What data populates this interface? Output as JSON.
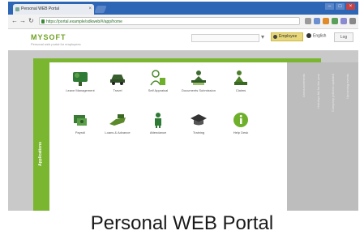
{
  "browser": {
    "tab_title": "Personal WEB Portal",
    "url_text": "https://portal.example/sdkweb/#/app/home",
    "window_controls": [
      "minimize-icon",
      "maximize-icon",
      "close-icon"
    ]
  },
  "header": {
    "logo_text": "MYSOFT",
    "tagline": "Personal web portal for employees",
    "search_placeholder": "",
    "user_label": "Employee",
    "language_label": "English",
    "logout_label": "Log"
  },
  "sidebar": {
    "label": "Applications"
  },
  "tiles": [
    {
      "label": "Leave Management",
      "icon": "tree-icon",
      "color": "#2f7a34"
    },
    {
      "label": "Travel",
      "icon": "car-icon",
      "color": "#3a5f2e"
    },
    {
      "label": "Self Appraisal",
      "icon": "person-form-icon",
      "color": "#4a8a2a"
    },
    {
      "label": "Documents Submission",
      "icon": "person-desk-icon",
      "color": "#3d6b30"
    },
    {
      "label": "Claims",
      "icon": "person-report-icon",
      "color": "#4d7f28"
    },
    {
      "label": "Payroll",
      "icon": "money-icon",
      "color": "#3a7a34"
    },
    {
      "label": "Loans & Advance",
      "icon": "hand-icon",
      "color": "#5a8a2a"
    },
    {
      "label": "Attendance",
      "icon": "person-clock-icon",
      "color": "#2f7a34"
    },
    {
      "label": "Training",
      "icon": "graduation-cap-icon",
      "color": "#333333"
    },
    {
      "label": "Help Desk",
      "icon": "info-icon",
      "color": "#6fb02a"
    }
  ],
  "right_panel": {
    "lines": [
      "Announcements",
      "Holidays list for the year",
      "Company policies updated",
      "Upcoming events"
    ]
  },
  "caption": "Personal WEB Portal",
  "colors": {
    "accent": "#7ab630",
    "chrome": "#2e66b6",
    "panel_bg": "#c9c9c9"
  }
}
